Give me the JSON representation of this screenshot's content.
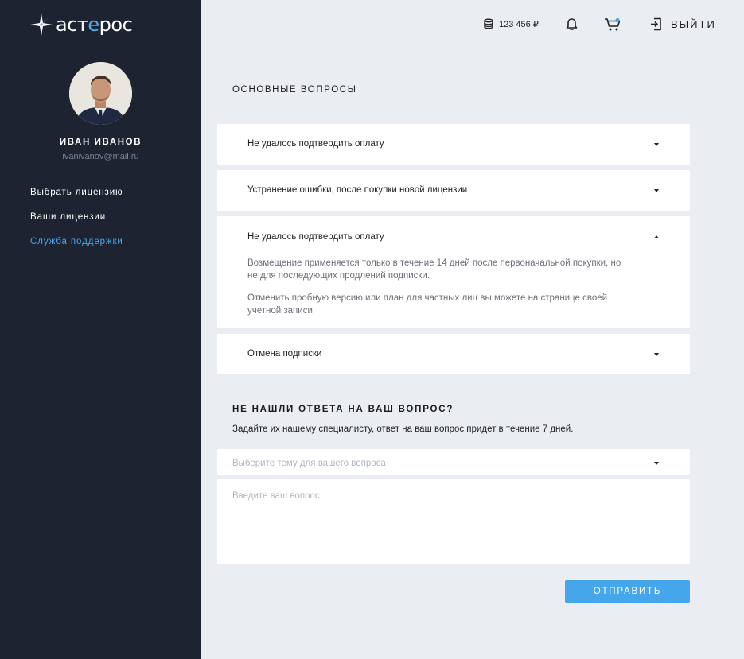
{
  "logo": {
    "text_main": "аст",
    "text_accent": "е",
    "text_end": "рос"
  },
  "user": {
    "name": "ИВАН ИВАНОВ",
    "email": "ivanivanov@mail.ru"
  },
  "nav": {
    "items": [
      {
        "label": "Выбрать лицензию",
        "active": false
      },
      {
        "label": "Ваши лицензии",
        "active": false
      },
      {
        "label": "Служба поддержки",
        "active": true
      }
    ]
  },
  "topbar": {
    "balance": "123 456 ₽",
    "logout_label": "ВЫЙТИ",
    "icons": [
      "coins-icon",
      "bell-icon",
      "cart-icon",
      "logout-icon"
    ]
  },
  "faq": {
    "title": "ОСНОВНЫЕ ВОПРОСЫ",
    "items": [
      {
        "question": "Не удалось подтвердить оплату",
        "expanded": false
      },
      {
        "question": "Устранение ошибки, после покупки новой лицензии",
        "expanded": false
      },
      {
        "question": "Не удалось подтвердить оплату",
        "expanded": true,
        "answer_1": "Возмещение применяется только в течение 14 дней после первоначальной покупки, но не для последующих продлений подписки.",
        "answer_2": "Отменить пробную версию или план для частных лиц вы можете на странице своей учетной записи"
      },
      {
        "question": "Отмена подписки",
        "expanded": false
      }
    ]
  },
  "question_form": {
    "title": "НЕ НАШЛИ ОТВЕТА НА ВАШ ВОПРОС?",
    "subtitle": "Задайте их нашему специалисту, ответ на ваш вопрос придет в течение 7 дней.",
    "topic_placeholder": "Выберите тему для вашего вопроса",
    "question_placeholder": "Введите ваш вопрос",
    "submit_label": "ОТПРАВИТЬ"
  },
  "colors": {
    "sidebar_bg": "#1e2331",
    "page_bg": "#eaeef2",
    "accent": "#45a6ec",
    "card_bg": "#ffffff"
  }
}
